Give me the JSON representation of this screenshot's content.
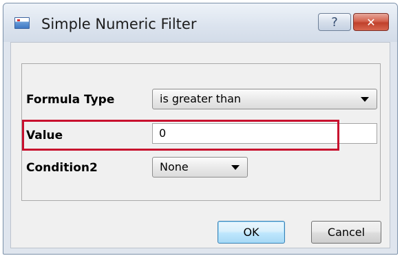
{
  "window": {
    "title": "Simple Numeric Filter",
    "help_glyph": "?",
    "close_glyph": "✕",
    "app_icon": "window-app-icon"
  },
  "form": {
    "formula_type": {
      "label": "Formula Type",
      "selected": "is greater than"
    },
    "value": {
      "label": "Value",
      "current": "0"
    },
    "condition2": {
      "label": "Condition2",
      "selected": "None"
    }
  },
  "buttons": {
    "ok": "OK",
    "cancel": "Cancel"
  },
  "colors": {
    "highlight": "#c8102e",
    "close_button": "#c0412c",
    "ok_button": "#bee6fd"
  }
}
